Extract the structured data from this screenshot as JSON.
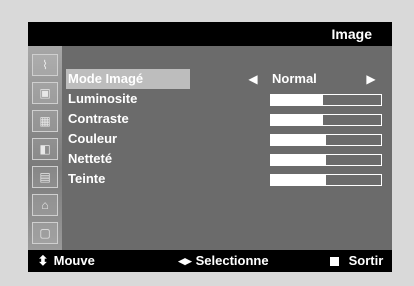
{
  "header": {
    "title": "Image"
  },
  "menu": {
    "items": [
      {
        "label": "Mode Imagé",
        "selected": true,
        "value": "Normal"
      },
      {
        "label": "Luminosite",
        "level": 0.47
      },
      {
        "label": "Contraste",
        "level": 0.47
      },
      {
        "label": "Couleur",
        "level": 0.5
      },
      {
        "label": "Netteté",
        "level": 0.5
      },
      {
        "label": "Teinte",
        "level": 0.5
      }
    ]
  },
  "footer": {
    "move_label": "Mouve",
    "select_label": "Selectionne",
    "exit_label": "Sortir"
  },
  "colors": {
    "osd_background": "#000000",
    "panel_gray": "#6b6b6b",
    "highlight": "#bdbdbd",
    "text": "#ffffff"
  },
  "icons": [
    "antenna-icon",
    "picture-icon",
    "grid-icon",
    "image-icon",
    "tools-icon",
    "lock-icon",
    "info-icon"
  ]
}
